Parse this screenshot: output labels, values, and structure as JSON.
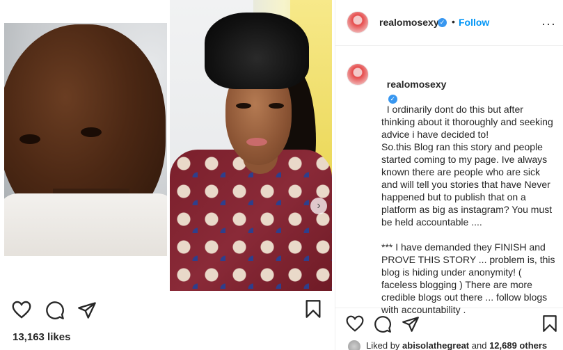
{
  "post": {
    "username": "realomosexy",
    "follow_separator": "•",
    "follow_label": "Follow",
    "more_label": "···",
    "caption_text": "I ordinarily dont do this but after thinking about it thoroughly and seeking advice i have decided to!\nSo.this Blog ran this story and people started coming to my page. Ive always known there are people who are sick and will tell you stories that have Never happened but to publish that on a platform as big as instagram? You must be held accountable ....\n\n*** I have demanded they FINISH and PROVE THIS STORY ... problem is, this blog is hiding under anonymity! ( faceless blogging ) There are more credible blogs out there ... follow blogs with accountability .",
    "verified_mark": "✓"
  },
  "left_actions": {
    "likes_count": "13,163 likes"
  },
  "panel_actions": {
    "liked_by_prefix": "Liked by ",
    "liked_by_user": "abisolathegreat",
    "liked_by_and": " and ",
    "liked_by_others": "12,689 others"
  },
  "carousel": {
    "next_glyph": "›"
  },
  "colors": {
    "accent": "#0095f6",
    "verified": "#3897f0",
    "text": "#262626"
  },
  "icons": [
    "heart-icon",
    "comment-icon",
    "share-icon",
    "bookmark-icon",
    "verified-icon",
    "more-icon",
    "carousel-next-icon"
  ]
}
